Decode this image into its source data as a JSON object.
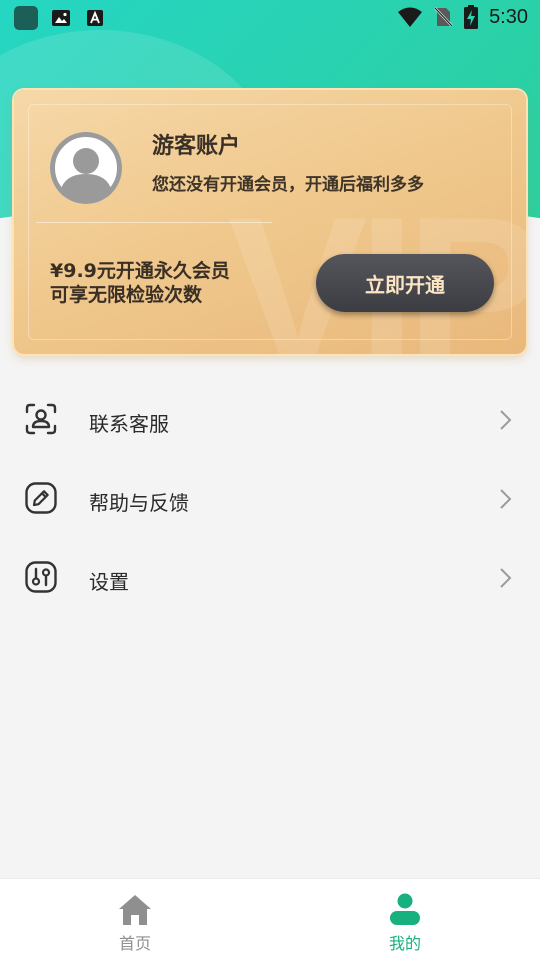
{
  "status_bar": {
    "time": "5:30",
    "icons": [
      "app-icon",
      "image-icon",
      "font-icon",
      "wifi-icon",
      "no-sim-icon",
      "battery-charging-icon"
    ]
  },
  "colors": {
    "header_teal": "#2ad3b0",
    "card_gold": "#f0c98e",
    "button_dark": "#45464b",
    "button_text": "#fbe5c4",
    "active_green": "#18b07e",
    "inactive_gray": "#8f8f8f"
  },
  "vip_card": {
    "account_name": "游客账户",
    "account_subtitle": "您还没有开通会员，开通后福利多多",
    "offer_line1": "¥9.9元开通永久会员",
    "offer_line2": "可享无限检验次数",
    "open_button_label": "立即开通",
    "watermark": "VIP"
  },
  "menu": {
    "items": [
      {
        "label": "联系客服",
        "icon": "customer-service-icon"
      },
      {
        "label": "帮助与反馈",
        "icon": "edit-feedback-icon"
      },
      {
        "label": "设置",
        "icon": "settings-sliders-icon"
      }
    ]
  },
  "bottom_nav": {
    "tabs": [
      {
        "label": "首页",
        "icon": "home-icon",
        "active": false
      },
      {
        "label": "我的",
        "icon": "person-icon",
        "active": true
      }
    ]
  }
}
